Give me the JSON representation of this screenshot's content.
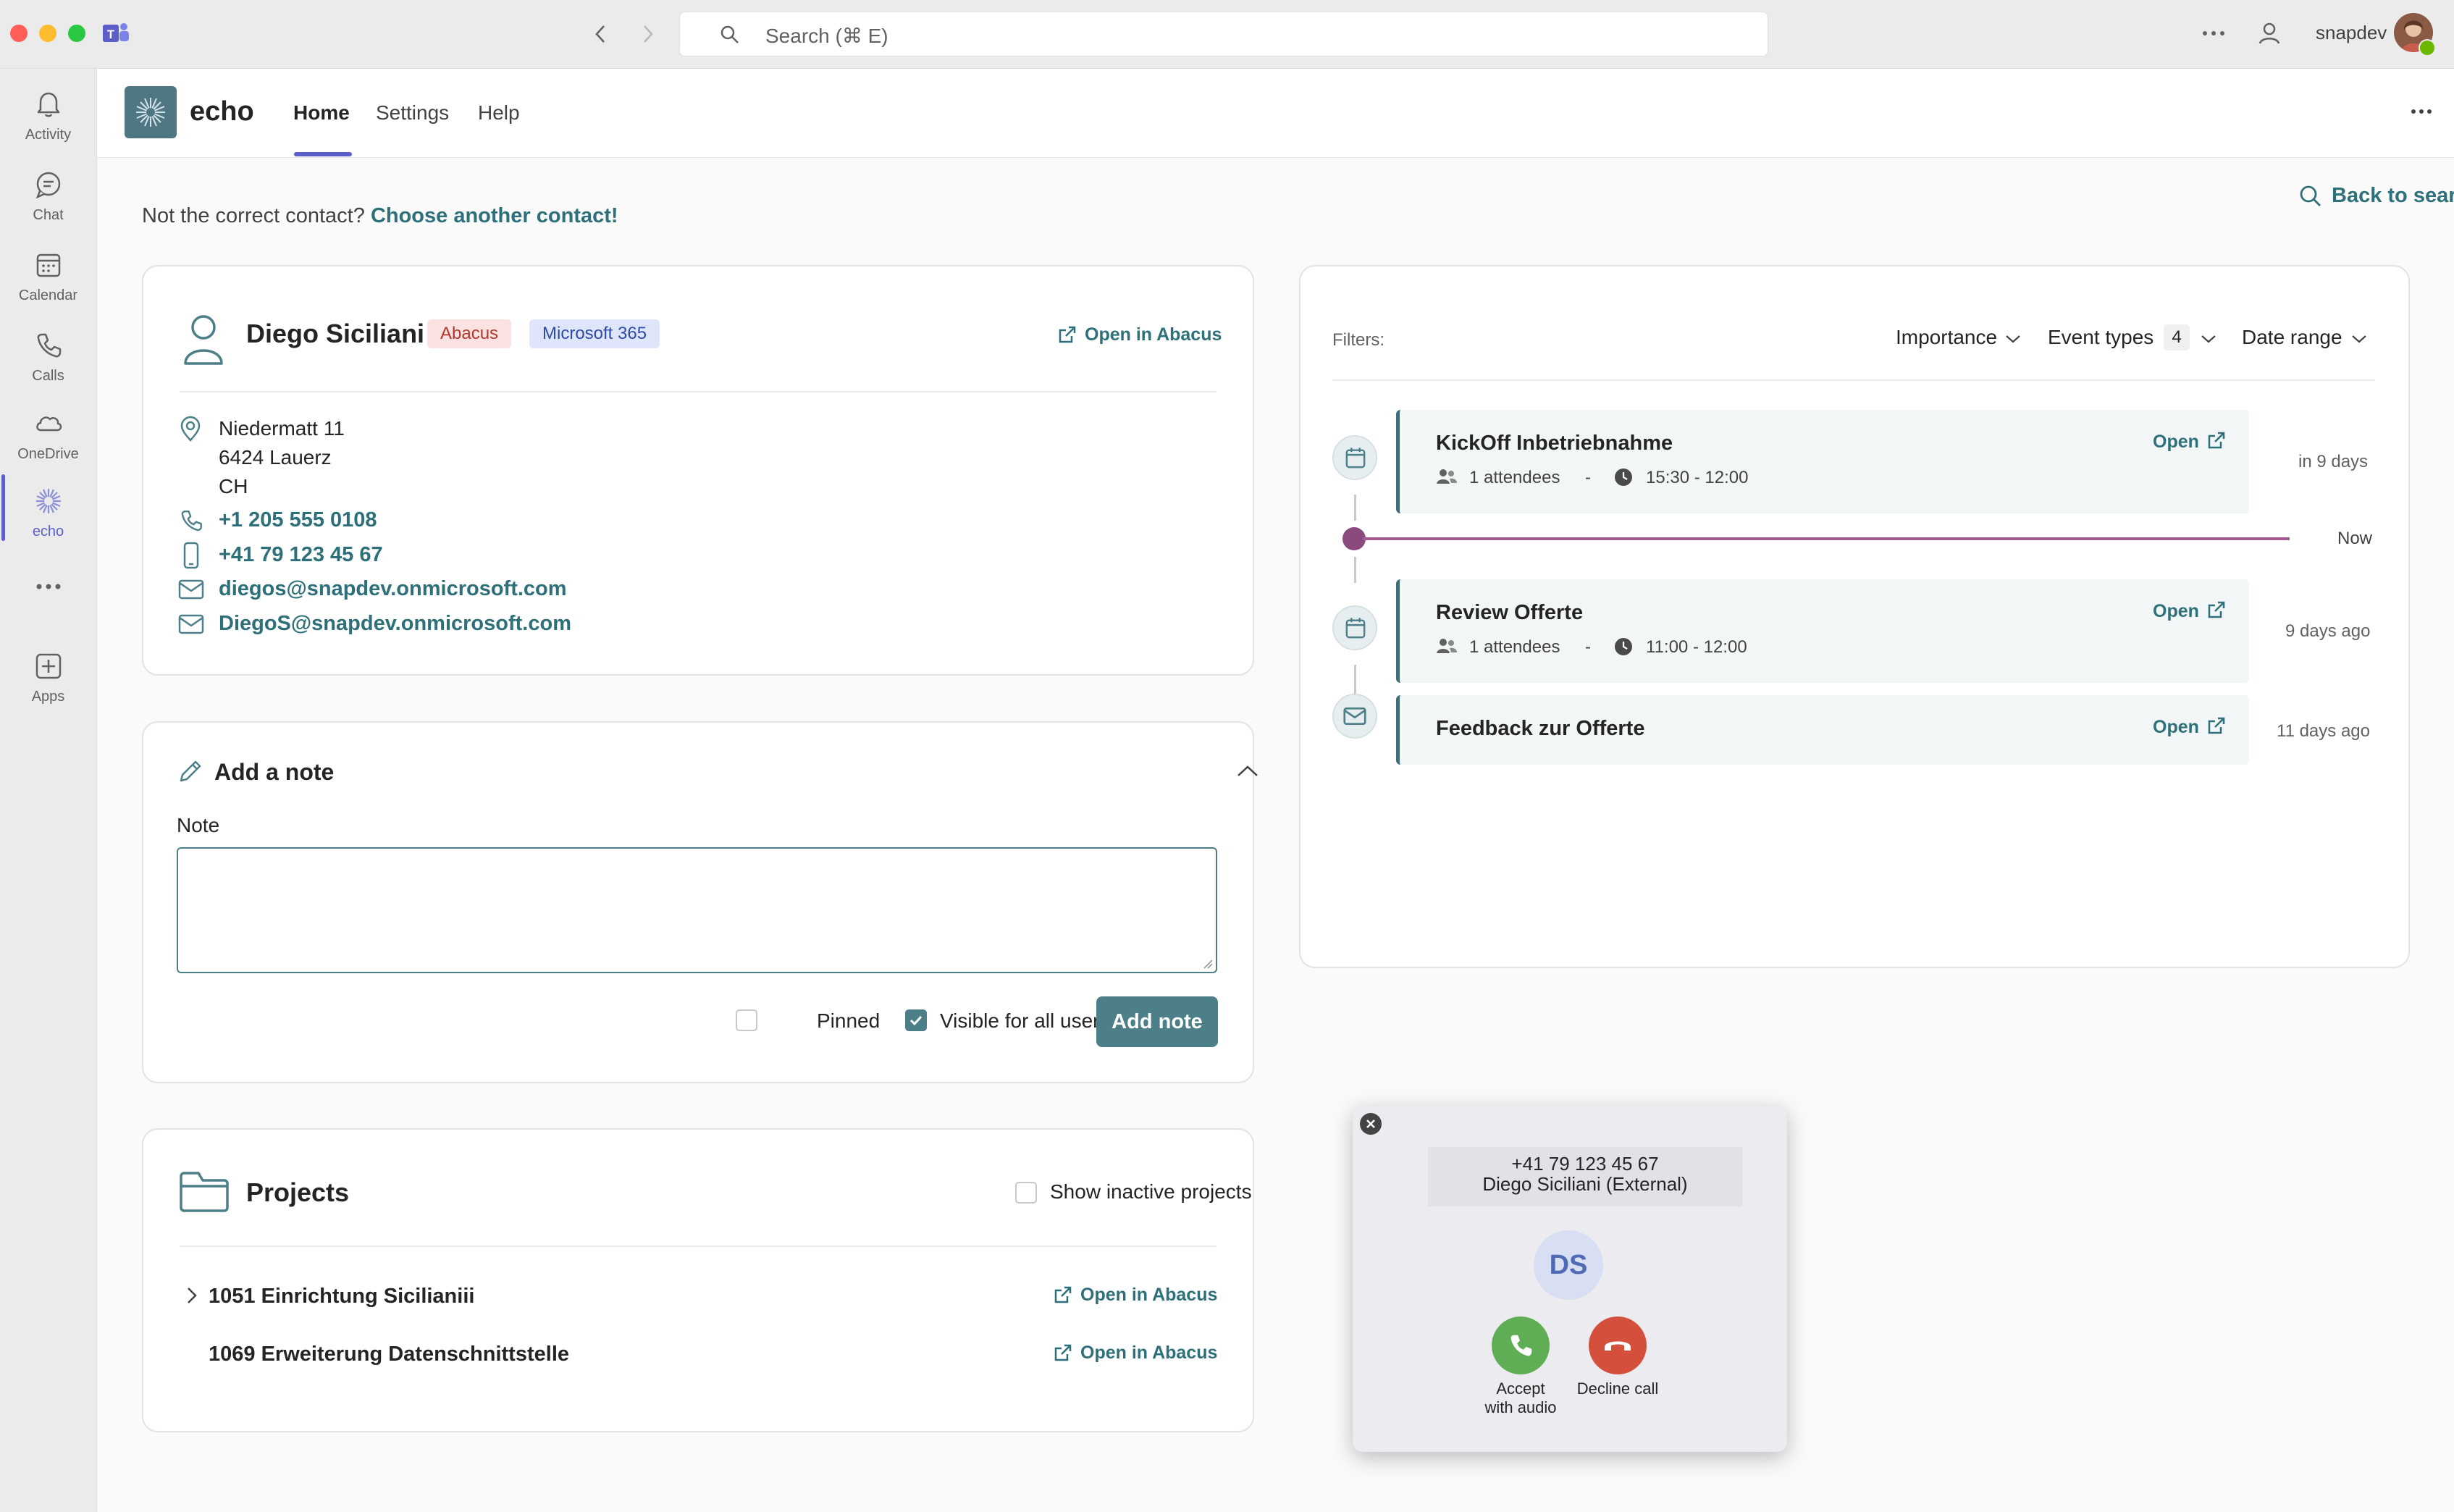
{
  "titlebar": {
    "search_placeholder": "Search (⌘ E)",
    "username": "snapdev"
  },
  "rail": {
    "items": [
      {
        "label": "Activity",
        "icon": "bell-icon"
      },
      {
        "label": "Chat",
        "icon": "chat-icon"
      },
      {
        "label": "Calendar",
        "icon": "calendar-icon"
      },
      {
        "label": "Calls",
        "icon": "phone-icon"
      },
      {
        "label": "OneDrive",
        "icon": "cloud-icon"
      },
      {
        "label": "echo",
        "icon": "echo-icon"
      },
      {
        "label": "Apps",
        "icon": "add-app-icon"
      }
    ]
  },
  "app": {
    "name": "echo",
    "tabs": [
      "Home",
      "Settings",
      "Help"
    ]
  },
  "main": {
    "not_correct": "Not the correct contact?",
    "choose_another": "Choose another contact!",
    "back_to_search": "Back to search"
  },
  "contact": {
    "name": "Diego Siciliani",
    "badges": [
      "Abacus",
      "Microsoft 365"
    ],
    "open_in_abacus": "Open in Abacus",
    "address": [
      "Niedermatt 11",
      "6424 Lauerz",
      "CH"
    ],
    "phone": "+1 205 555 0108",
    "mobile": "+41 79 123 45 67",
    "email1": "diegos@snapdev.onmicrosoft.com",
    "email2": "DiegoS@snapdev.onmicrosoft.com"
  },
  "note": {
    "title": "Add a note",
    "label": "Note",
    "pinned": "Pinned",
    "visible_all": "Visible for all users",
    "add_button": "Add note"
  },
  "projects": {
    "title": "Projects",
    "show_inactive": "Show inactive projects",
    "items": [
      {
        "name": "1051 Einrichtung Sicilianiii",
        "open": "Open in Abacus"
      },
      {
        "name": "1069 Erweiterung Datenschnittstelle",
        "open": "Open in Abacus"
      }
    ]
  },
  "timeline": {
    "filters_label": "Filters:",
    "importance": "Importance",
    "event_types": "Event types",
    "event_types_count": "4",
    "date_range": "Date range",
    "now": "Now",
    "events": [
      {
        "title": "KickOff Inbetriebnahme",
        "attendees": "1 attendees",
        "sep": "-",
        "time": "15:30 - 12:00",
        "open": "Open",
        "rel": "in 9 days"
      },
      {
        "title": "Review Offerte",
        "attendees": "1 attendees",
        "sep": "-",
        "time": "11:00 - 12:00",
        "open": "Open",
        "rel": "9 days ago"
      },
      {
        "title": "Feedback zur Offerte",
        "open": "Open",
        "rel": "11 days ago"
      }
    ]
  },
  "call": {
    "number": "+41 79 123 45 67",
    "caller": "Diego Siciliani (External)",
    "initials": "DS",
    "accept_line1": "Accept",
    "accept_line2": "with audio",
    "decline": "Decline call"
  },
  "colors": {
    "accent_teal": "#2e7079",
    "teams_purple": "#5b5fc7",
    "accept_green": "#5fae55",
    "decline_red": "#d4503c"
  }
}
